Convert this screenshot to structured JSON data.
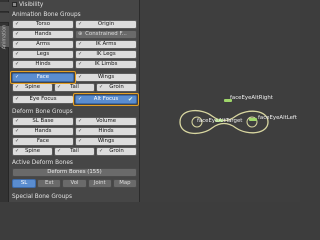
{
  "side_tab": {
    "label": "Animation"
  },
  "visibility": {
    "label": "Visibility"
  },
  "animation_bone_groups": {
    "header": "Animation Bone Groups",
    "rows": [
      [
        "Torso",
        "Origin"
      ],
      [
        "Hands",
        "Constrained F..."
      ],
      [
        "Arms",
        "IK Arms"
      ],
      [
        "Legs",
        "IK Legs"
      ],
      [
        "Hinds",
        "IK Limbs"
      ],
      [
        "Face",
        "Wings"
      ],
      [
        "Spine",
        "Tail",
        "Groin"
      ],
      [
        "Eye Focus",
        "Alt Focus"
      ]
    ]
  },
  "deform_bone_groups": {
    "header": "Deform Bone Groups",
    "rows": [
      [
        "SL Base",
        "Volume"
      ],
      [
        "Hands",
        "Hinds"
      ],
      [
        "Face",
        "Wings"
      ],
      [
        "Spine",
        "Tail",
        "Groin"
      ]
    ]
  },
  "active_deform_bones": {
    "header": "Active Deform Bones",
    "dropdown": "Deform Bones (155)",
    "tabs": [
      "SL",
      "Ext",
      "Vol",
      "Joint",
      "Map"
    ]
  },
  "special_bone_groups": {
    "header": "Special Bone Groups"
  },
  "viewport": {
    "labels": [
      "faceEyeAltRight",
      "faceEyeAltTarget",
      "faceEyeAltLeft"
    ]
  },
  "colors": {
    "highlight": "#e5a024",
    "active_button": "#5a8dd0",
    "bone_green": "#9fd66a",
    "curve_yellow": "#d8d6a0"
  }
}
